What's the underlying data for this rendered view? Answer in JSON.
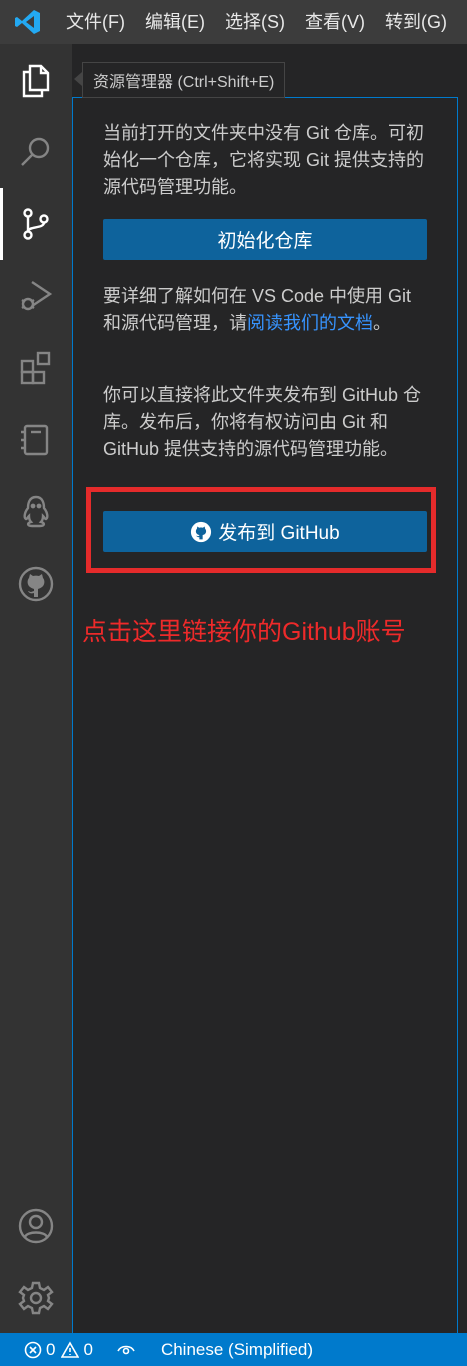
{
  "titlebar": {
    "menu": [
      "文件(F)",
      "编辑(E)",
      "选择(S)",
      "查看(V)",
      "转到(G)"
    ]
  },
  "activitybar": {
    "items": [
      "explorer-icon",
      "search-icon",
      "source-control-icon",
      "run-debug-icon",
      "extensions-icon",
      "notebook-icon",
      "qq-icon",
      "github-icon"
    ],
    "bottom": [
      "account-icon",
      "settings-gear-icon"
    ]
  },
  "tooltip": {
    "text": "资源管理器 (Ctrl+Shift+E)"
  },
  "sidebar": {
    "para1": "当前打开的文件夹中没有 Git 仓库。可初始化一个仓库，它将实现 Git 提供支持的源代码管理功能。",
    "init_button": "初始化仓库",
    "para2_prefix": "要详细了解如何在 VS Code 中使用 Git 和源代码管理，请",
    "para2_link": "阅读我们的文档",
    "para2_suffix": "。",
    "para3": "你可以直接将此文件夹发布到 GitHub 仓库。发布后，你将有权访问由 Git 和 GitHub 提供支持的源代码管理功能。",
    "publish_button": "发布到 GitHub"
  },
  "annotation": {
    "text": "点击这里链接你的Github账号",
    "color": "#e52b2b"
  },
  "statusbar": {
    "errors": "0",
    "warnings": "0",
    "language": "Chinese (Simplified)"
  },
  "colors": {
    "accent": "#007acc",
    "button": "#0e639c",
    "link": "#3794ff"
  }
}
